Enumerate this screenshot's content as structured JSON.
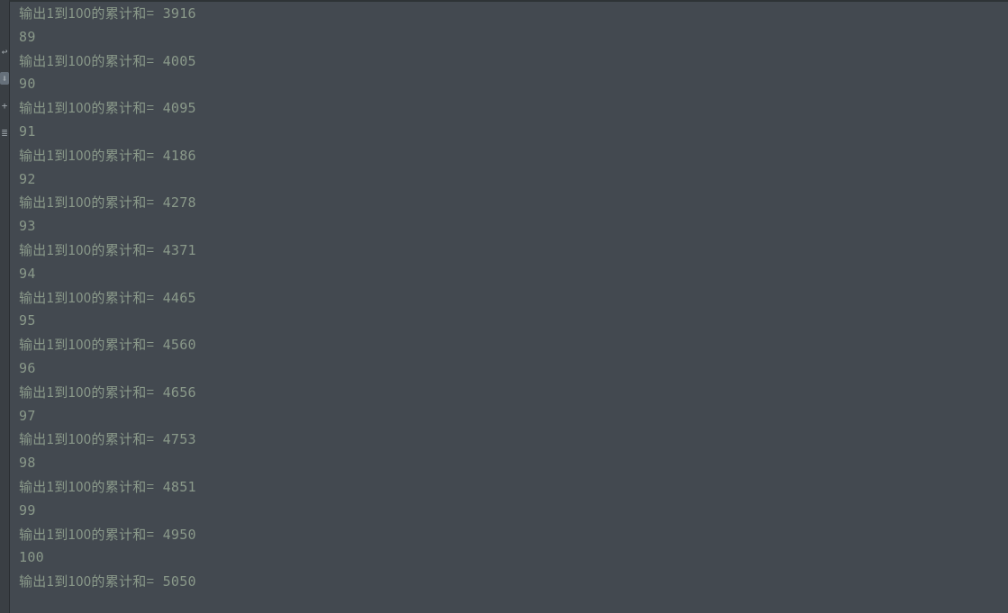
{
  "gutter_icons": [
    {
      "name": "return-icon",
      "glyph": "↩",
      "highlighted": false
    },
    {
      "name": "download-icon",
      "glyph": "⬇",
      "highlighted": true
    },
    {
      "name": "plus-icon",
      "glyph": "+",
      "highlighted": false
    },
    {
      "name": "list-icon",
      "glyph": "≣",
      "highlighted": false
    }
  ],
  "console_output": {
    "label": "输出1到100的累计和=",
    "lines": [
      {
        "type": "sum",
        "value": "3916"
      },
      {
        "type": "num",
        "value": "89"
      },
      {
        "type": "sum",
        "value": "4005"
      },
      {
        "type": "num",
        "value": "90"
      },
      {
        "type": "sum",
        "value": "4095"
      },
      {
        "type": "num",
        "value": "91"
      },
      {
        "type": "sum",
        "value": "4186"
      },
      {
        "type": "num",
        "value": "92"
      },
      {
        "type": "sum",
        "value": "4278"
      },
      {
        "type": "num",
        "value": "93"
      },
      {
        "type": "sum",
        "value": "4371"
      },
      {
        "type": "num",
        "value": "94"
      },
      {
        "type": "sum",
        "value": "4465"
      },
      {
        "type": "num",
        "value": "95"
      },
      {
        "type": "sum",
        "value": "4560"
      },
      {
        "type": "num",
        "value": "96"
      },
      {
        "type": "sum",
        "value": "4656"
      },
      {
        "type": "num",
        "value": "97"
      },
      {
        "type": "sum",
        "value": "4753"
      },
      {
        "type": "num",
        "value": "98"
      },
      {
        "type": "sum",
        "value": "4851"
      },
      {
        "type": "num",
        "value": "99"
      },
      {
        "type": "sum",
        "value": "4950"
      },
      {
        "type": "num",
        "value": "100"
      },
      {
        "type": "sum",
        "value": "5050"
      }
    ]
  }
}
